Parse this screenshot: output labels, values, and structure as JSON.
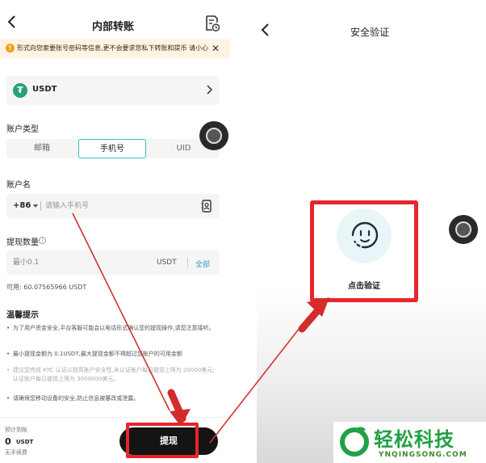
{
  "transfer": {
    "title": "内部转账",
    "notice": "形式向您索要账号密码等信息,更不会要求您私下转账和提币 请小心",
    "coin": {
      "symbol": "USDT",
      "icon": "tether-icon"
    },
    "account_type": {
      "label": "账户类型",
      "options": [
        "邮箱",
        "手机号",
        "UID"
      ],
      "selected": "手机号"
    },
    "account_name": {
      "label": "账户名",
      "country_code": "+86",
      "placeholder": "请输入手机号"
    },
    "amount": {
      "label": "提现数量",
      "placeholder": "最小0.1",
      "unit": "USDT",
      "all": "全部",
      "available": "可用: 60.07565966 USDT"
    },
    "tips": {
      "title": "温馨提示",
      "items": [
        "为了用户资金安全,平台客服可能会以电话形式确认您的提现操作,请您注意接听。",
        "最小提现金额为 0.1USDT,最大提现金额不得超过您账户的可用金额",
        "建议您完成 KYC 认证以提高账户安全性,未认证账户每日提现上限为 20000美元; 认证账户每日提现上限为 3000000美元。",
        "请确保您移动设备的安全,防止信息被篡改或泄露。"
      ]
    },
    "bottom": {
      "estimated_label": "预计到账",
      "estimated_value": "0",
      "estimated_unit": "USDT",
      "fee": "无手续费",
      "submit_label": "提现"
    }
  },
  "verify": {
    "title": "安全验证",
    "face_label": "点击验证"
  },
  "watermark": {
    "cn": "轻松科技",
    "en": "YNQINGSONG.COM"
  },
  "colors": {
    "accent_teal": "#3cbcbc",
    "tether_green": "#26a17b",
    "annotation_red": "#e8242c",
    "link_blue": "#2a9fc9",
    "watermark_green": "#22a045"
  }
}
